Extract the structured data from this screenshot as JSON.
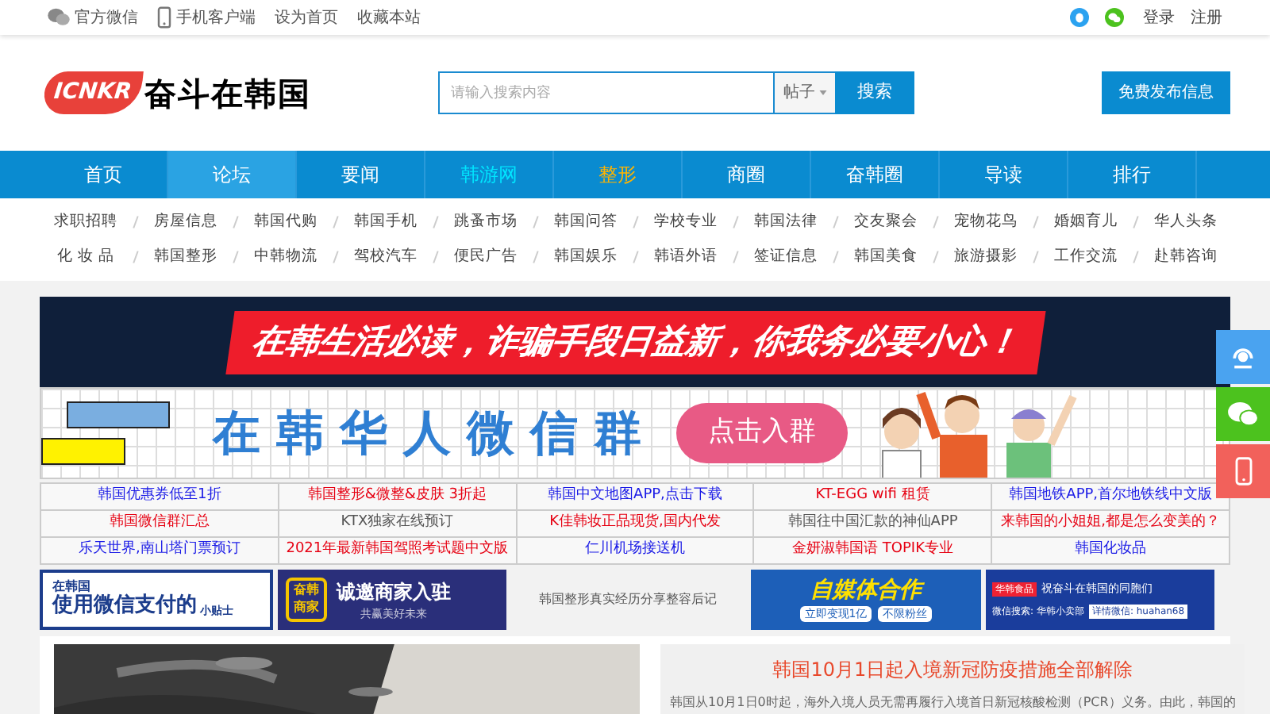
{
  "top_bar": {
    "left": [
      {
        "kind": "wechat",
        "label": "官方微信"
      },
      {
        "kind": "phone",
        "label": "手机客户端"
      },
      {
        "kind": "text",
        "label": "设为首页"
      },
      {
        "kind": "text",
        "label": "收藏本站"
      }
    ],
    "right": [
      "登录",
      "注册"
    ]
  },
  "header": {
    "logo_mark": "ICNKR",
    "site_name": "奋斗在韩国",
    "search": {
      "placeholder": "请输入搜索内容",
      "scope": "帖子",
      "button": "搜索"
    },
    "publish_button": "免费发布信息"
  },
  "nav": [
    {
      "label": "首页",
      "selected": false,
      "kind": "plain"
    },
    {
      "label": "论坛",
      "selected": true,
      "kind": "plain"
    },
    {
      "label": "要闻",
      "selected": false,
      "kind": "plain"
    },
    {
      "label": "韩游网",
      "selected": false,
      "kind": "travel"
    },
    {
      "label": "整形",
      "selected": false,
      "kind": "beauty"
    },
    {
      "label": "商圈",
      "selected": false,
      "kind": "plain"
    },
    {
      "label": "奋韩圈",
      "selected": false,
      "kind": "plain"
    },
    {
      "label": "导读",
      "selected": false,
      "kind": "plain"
    },
    {
      "label": "排行",
      "selected": false,
      "kind": "plain"
    }
  ],
  "categories": [
    [
      "求职招聘",
      "房屋信息",
      "韩国代购",
      "韩国手机",
      "跳蚤市场",
      "韩国问答",
      "学校专业",
      "韩国法律",
      "交友聚会",
      "宠物花鸟",
      "婚姻育儿",
      "华人头条"
    ],
    [
      "化 妆 品",
      "韩国整形",
      "中韩物流",
      "驾校汽车",
      "便民广告",
      "韩国娱乐",
      "韩语外语",
      "签证信息",
      "韩国美食",
      "旅游摄影",
      "工作交流",
      "赴韩咨询"
    ]
  ],
  "banners": [
    {
      "kind": "notice",
      "text": "在韩生活必读，诈骗手段日益新，你我务必要小心！"
    },
    {
      "kind": "group",
      "text": "在韩华人微信群",
      "button": "点击入群"
    }
  ],
  "links": [
    [
      {
        "text": "韩国优惠券低至1折",
        "color": "#1a1ae6"
      },
      {
        "text": "韩国整形&微整&皮肤 3折起",
        "color": "#e60012"
      },
      {
        "text": "韩国中文地图APP,点击下载",
        "color": "#1a1ae6"
      },
      {
        "text": "KT-EGG wifi 租赁",
        "color": "#e60012"
      },
      {
        "text": "韩国地铁APP,首尔地铁线中文版",
        "color": "#1a1ae6"
      }
    ],
    [
      {
        "text": "韩国微信群汇总",
        "color": "#e60012"
      },
      {
        "text": "KTX独家在线预订",
        "color": "#555555"
      },
      {
        "text": "K佳韩妆正品现货,国内代发",
        "color": "#e60012"
      },
      {
        "text": "韩国往中国汇款的神仙APP",
        "color": "#555555"
      },
      {
        "text": "来韩国的小姐姐,都是怎么变美的？",
        "color": "#e60012"
      }
    ],
    [
      {
        "text": "乐天世界,南山塔门票预订",
        "color": "#1a1ae6"
      },
      {
        "text": "2021年最新韩国驾照考试题中文版",
        "color": "#e60012"
      },
      {
        "text": "仁川机场接送机",
        "color": "#1a1ae6"
      },
      {
        "text": "金妍淑韩国语 TOPIK专业",
        "color": "#e60012"
      },
      {
        "text": "韩国化妆品",
        "color": "#1a1ae6"
      }
    ]
  ],
  "ads": [
    {
      "kind": "wechat_pay",
      "lines": [
        "在韩国",
        "使用微信支付的",
        "小贴士"
      ]
    },
    {
      "kind": "merchant",
      "lines": [
        "奋韩商家",
        "诚邀商家入驻",
        "共赢美好未来"
      ]
    },
    {
      "kind": "text",
      "lines": [
        "韩国整形真实经历分享整容后记"
      ]
    },
    {
      "kind": "media",
      "lines": [
        "自媒体合作",
        "立即变现1亿",
        "不限粉丝"
      ]
    },
    {
      "kind": "food",
      "lines": [
        "华韩食品",
        "祝奋斗在韩国的同胞们",
        "微信搜索: 华韩小卖部",
        "详情微信: huahan68"
      ]
    }
  ],
  "news": {
    "title": "韩国10月1日起入境新冠防疫措施全部解除",
    "summary": "韩国从10月1日0时起，海外入境人员无需再履行入境首日新冠核酸检测（PCR）义务。由此，韩国的"
  },
  "float_buttons": [
    {
      "kind": "service"
    },
    {
      "kind": "wechat"
    },
    {
      "kind": "phone"
    }
  ]
}
